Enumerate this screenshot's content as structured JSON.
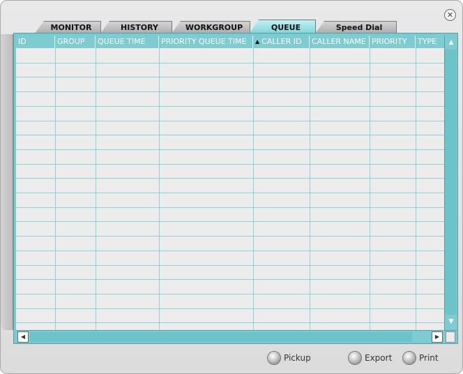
{
  "window": {
    "close_icon": "close-icon"
  },
  "tabs": [
    {
      "label": "MONITOR"
    },
    {
      "label": "HISTORY"
    },
    {
      "label": "WORKGROUP"
    },
    {
      "label": "QUEUE",
      "active": true
    },
    {
      "label": "Speed Dial"
    }
  ],
  "table": {
    "columns": [
      {
        "label": "ID"
      },
      {
        "label": "GROUP"
      },
      {
        "label": "QUEUE TIME"
      },
      {
        "label": "PRIORITY QUEUE TIME"
      },
      {
        "label": "CALLER ID",
        "sorted": "ascending"
      },
      {
        "label": "CALLER NAME"
      },
      {
        "label": "PRIORITY"
      },
      {
        "label": "TYPE"
      }
    ],
    "rows": []
  },
  "actions": {
    "pickup_label": "Pickup",
    "export_label": "Export",
    "print_label": "Print"
  },
  "colors": {
    "accent": "#7fcbd2",
    "grid_line": "#8fd0d6",
    "cell_bg": "#ececec"
  }
}
